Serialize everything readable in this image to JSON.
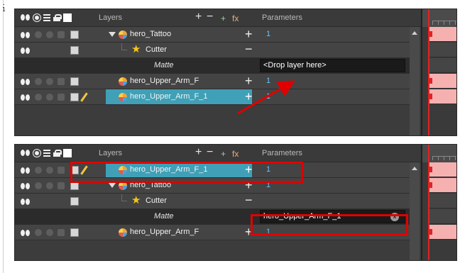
{
  "gutter_label": "1",
  "panel_top": {
    "header": {
      "layers_title": "Layers",
      "params_title": "Parameters",
      "add_symbol": "+",
      "remove_symbol": "−",
      "add_peg_symbol": "+",
      "fx_symbol": "fx"
    },
    "rows": [
      {
        "name": "hero_Tattoo",
        "param": "1",
        "action": "+"
      },
      {
        "name": "Cutter",
        "action": "−"
      },
      {
        "matte_label": "Matte",
        "matte_value": "<Drop layer here>"
      },
      {
        "name": "hero_Upper_Arm_F",
        "param": "1",
        "action": "+"
      },
      {
        "name": "hero_Upper_Arm_F_1",
        "param": "1",
        "action": "+"
      }
    ]
  },
  "panel_bottom": {
    "header": {
      "layers_title": "Layers",
      "params_title": "Parameters",
      "add_symbol": "+",
      "remove_symbol": "−",
      "add_peg_symbol": "+",
      "fx_symbol": "fx"
    },
    "rows": [
      {
        "name": "hero_Upper_Arm_F_1",
        "param": "1",
        "action": "+"
      },
      {
        "name": "hero_Tattoo",
        "param": "1",
        "action": "+"
      },
      {
        "name": "Cutter",
        "action": "−"
      },
      {
        "matte_label": "Matte",
        "matte_value": "hero_Upper_Arm_F_1"
      },
      {
        "name": "hero_Upper_Arm_F",
        "param": "1",
        "action": "+"
      }
    ]
  },
  "colors": {
    "panel_bg": "#3c3c3c",
    "selected_row": "#3fa0b7",
    "param_text": "#68c0ff",
    "highlight_box": "#e00000",
    "playhead": "#e22222",
    "keyframe_cell": "#f5b0b0"
  },
  "icons": [
    "eye-icon",
    "dot-icon",
    "stack-icon",
    "lock-icon",
    "color-swatch-icon",
    "layer-drawing-icon",
    "star-cutter-icon",
    "pencil-icon",
    "clear-icon",
    "disclosure-triangle-icon"
  ]
}
